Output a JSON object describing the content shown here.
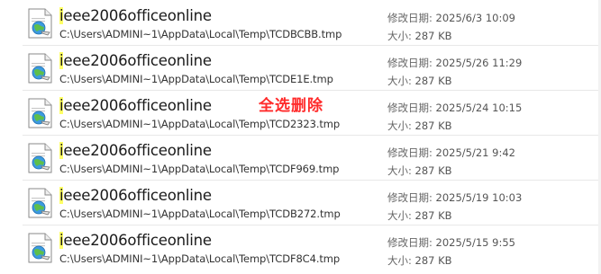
{
  "results": [
    {
      "title_highlight": "i",
      "title_rest": "eee2006officeonline",
      "path": "C:\\Users\\ADMINI~1\\AppData\\Local\\Temp\\TCDBCBB.tmp",
      "date_label": "修改日期:",
      "date": "2025/6/3 10:09",
      "size_label": "大小:",
      "size": "287 KB"
    },
    {
      "title_highlight": "i",
      "title_rest": "eee2006officeonline",
      "path": "C:\\Users\\ADMINI~1\\AppData\\Local\\Temp\\TCDE1E.tmp",
      "date_label": "修改日期:",
      "date": "2025/5/26 11:29",
      "size_label": "大小:",
      "size": "287 KB"
    },
    {
      "title_highlight": "i",
      "title_rest": "eee2006officeonline",
      "path": "C:\\Users\\ADMINI~1\\AppData\\Local\\Temp\\TCD2323.tmp",
      "date_label": "修改日期:",
      "date": "2025/5/24 10:15",
      "size_label": "大小:",
      "size": "287 KB"
    },
    {
      "title_highlight": "i",
      "title_rest": "eee2006officeonline",
      "path": "C:\\Users\\ADMINI~1\\AppData\\Local\\Temp\\TCDF969.tmp",
      "date_label": "修改日期:",
      "date": "2025/5/21 9:42",
      "size_label": "大小:",
      "size": "287 KB"
    },
    {
      "title_highlight": "i",
      "title_rest": "eee2006officeonline",
      "path": "C:\\Users\\ADMINI~1\\AppData\\Local\\Temp\\TCDB272.tmp",
      "date_label": "修改日期:",
      "date": "2025/5/19 10:03",
      "size_label": "大小:",
      "size": "287 KB"
    },
    {
      "title_highlight": "i",
      "title_rest": "eee2006officeonline",
      "path": "C:\\Users\\ADMINI~1\\AppData\\Local\\Temp\\TCDF8C4.tmp",
      "date_label": "修改日期:",
      "date": "2025/5/15 9:55",
      "size_label": "大小:",
      "size": "287 KB"
    }
  ],
  "overlay_text": "全选删除",
  "colors": {
    "highlight": "#ffff66",
    "overlay": "#ff2a2a"
  },
  "icon": "internet-shortcut-file-icon"
}
